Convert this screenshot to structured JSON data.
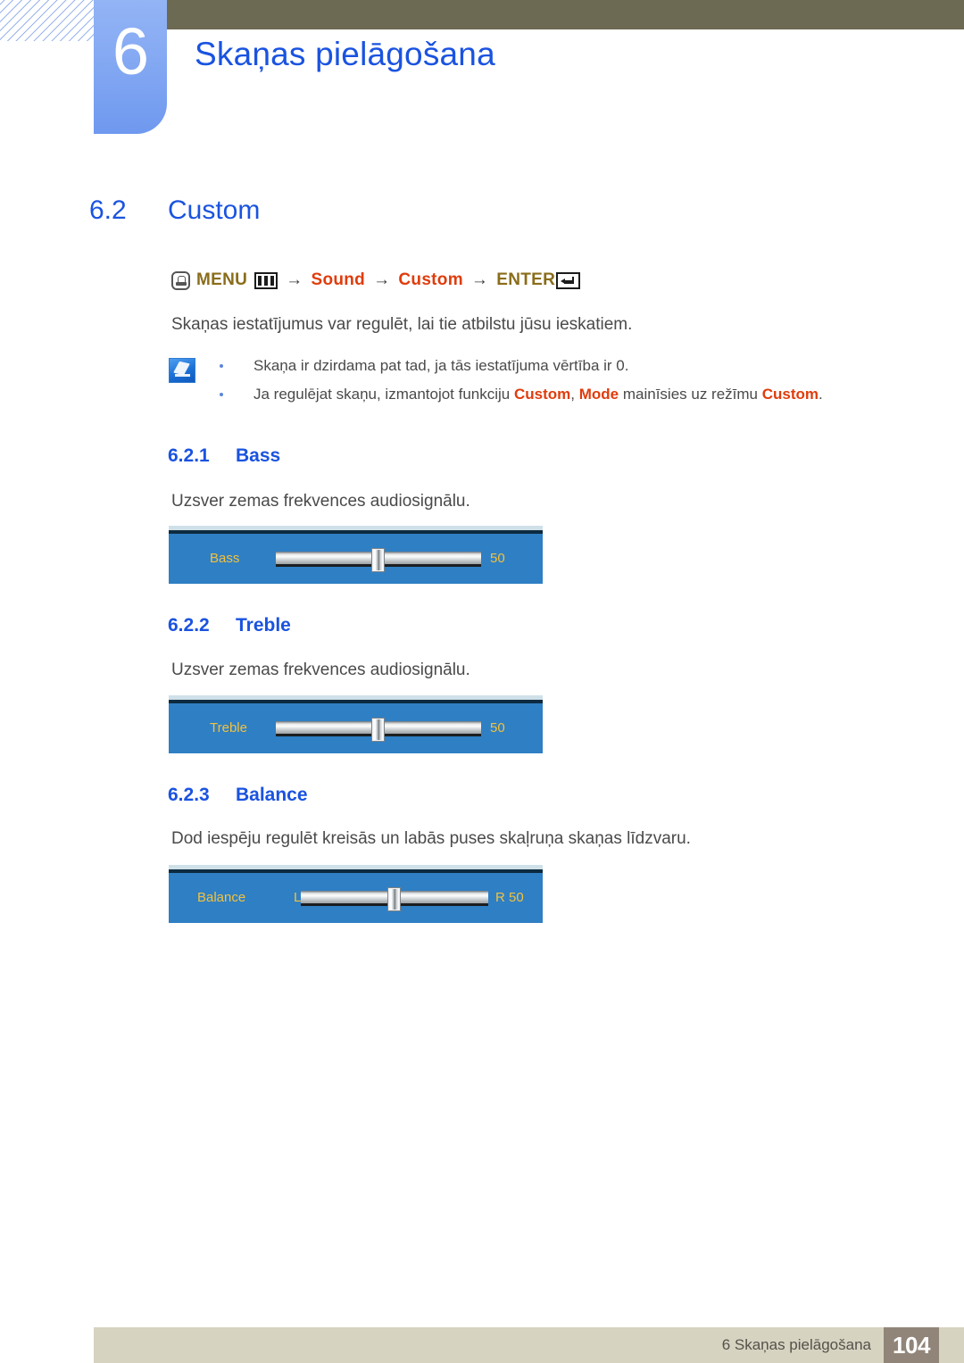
{
  "header": {
    "chapter_number": "6",
    "chapter_title": "Skaņas pielāgošana"
  },
  "section": {
    "number": "6.2",
    "title": "Custom"
  },
  "menu_path": {
    "menu_label": "MENU",
    "arrow": "→",
    "sound_label": "Sound",
    "custom_label": "Custom",
    "enter_label": "ENTER",
    "hand_icon": "hand-press-icon",
    "bars_icon": "menu-bars-icon",
    "enter_icon": "enter-return-icon"
  },
  "intro": "Skaņas iestatījumus var regulēt, lai tie atbilstu jūsu ieskatiem.",
  "note": {
    "icon": "note-pencil-icon",
    "items": [
      {
        "prefix": "Skaņa ir dzirdama pat tad, ja tās iestatījuma vērtība ir 0.",
        "kw1": "",
        "mid": "",
        "kw2": "",
        "mid2": "",
        "kw3": "",
        "suffix": ""
      },
      {
        "prefix": "Ja regulējat skaņu, izmantojot funkciju ",
        "kw1": "Custom",
        "mid": ", ",
        "kw2": "Mode",
        "mid2": " mainīsies uz režīmu ",
        "kw3": "Custom",
        "suffix": "."
      }
    ]
  },
  "subsections": [
    {
      "number": "6.2.1",
      "title": "Bass",
      "description": "Uzsver zemas frekvences audiosignālu.",
      "osd": {
        "name": "Bass",
        "value": "50"
      }
    },
    {
      "number": "6.2.2",
      "title": "Treble",
      "description": "Uzsver zemas frekvences audiosignālu.",
      "osd": {
        "name": "Treble",
        "value": "50"
      }
    },
    {
      "number": "6.2.3",
      "title": "Balance",
      "description": "Dod iespēju regulēt kreisās un labās puses skaļruņa skaņas līdzvaru.",
      "osd": {
        "name": "Balance",
        "left_value": "L 50",
        "right_value": "R 50"
      }
    }
  ],
  "footer": {
    "text": "6 Skaņas pielāgošana",
    "page_number": "104"
  },
  "colors": {
    "heading_blue": "#1a53e0",
    "menu_gold": "#8a6d1a",
    "keyword_red": "#e03c0c",
    "osd_blue": "#2f7fc4",
    "osd_gold": "#f2c23d",
    "topbar_olive": "#6d6a54",
    "footer_tan": "#d7d3c1",
    "page_box_brown": "#91857a"
  }
}
